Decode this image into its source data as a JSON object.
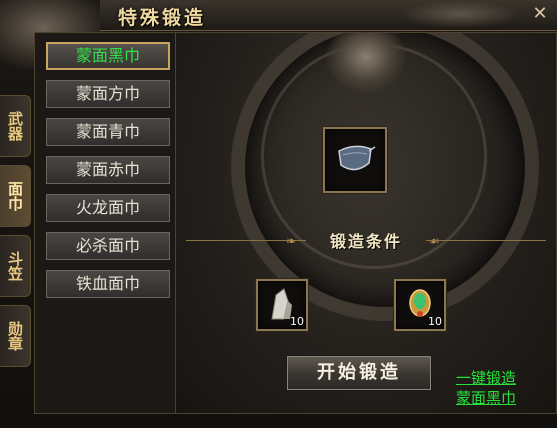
{
  "window": {
    "title": "特殊锻造",
    "close_glyph": "✕"
  },
  "categories": [
    {
      "label": "武器",
      "active": false
    },
    {
      "label": "面巾",
      "active": true
    },
    {
      "label": "斗笠",
      "active": false
    },
    {
      "label": "勋章",
      "active": false
    }
  ],
  "items": [
    {
      "label": "蒙面黑巾",
      "selected": true
    },
    {
      "label": "蒙面方巾",
      "selected": false
    },
    {
      "label": "蒙面青巾",
      "selected": false
    },
    {
      "label": "蒙面赤巾",
      "selected": false
    },
    {
      "label": "火龙面巾",
      "selected": false
    },
    {
      "label": "必杀面巾",
      "selected": false
    },
    {
      "label": "铁血面巾",
      "selected": false
    }
  ],
  "forge": {
    "target_icon": "face-mask-icon",
    "conditions_label": "锻造条件",
    "materials": [
      {
        "icon": "crystal-ore-icon",
        "count": "10"
      },
      {
        "icon": "gem-amulet-icon",
        "count": "10"
      }
    ],
    "start_button": "开始锻造",
    "quick_forge_link": "一键锻造",
    "quick_forge_item": "蒙面黑巾"
  },
  "colors": {
    "selected_text": "#2fe24a",
    "gold_border": "#c8a45c",
    "link": "#28e23c"
  }
}
